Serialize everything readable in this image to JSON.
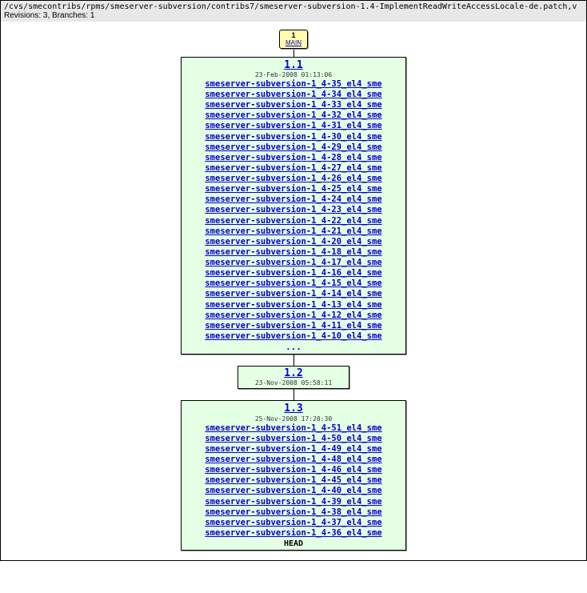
{
  "header": {
    "path": "/cvs/smecontribs/rpms/smeserver-subversion/contribs7/smeserver-subversion-1.4-ImplementReadWriteAccessLocale-de.patch,v",
    "stats": "Revisions: 3, Branches: 1"
  },
  "branch": {
    "num": "1",
    "name": "MAIN"
  },
  "rev1": {
    "title": "1.1",
    "date": "23-Feb-2008 01:13:06",
    "tags": [
      "smeserver-subversion-1_4-35_el4_sme",
      "smeserver-subversion-1_4-34_el4_sme",
      "smeserver-subversion-1_4-33_el4_sme",
      "smeserver-subversion-1_4-32_el4_sme",
      "smeserver-subversion-1_4-31_el4_sme",
      "smeserver-subversion-1_4-30_el4_sme",
      "smeserver-subversion-1_4-29_el4_sme",
      "smeserver-subversion-1_4-28_el4_sme",
      "smeserver-subversion-1_4-27_el4_sme",
      "smeserver-subversion-1_4-26_el4_sme",
      "smeserver-subversion-1_4-25_el4_sme",
      "smeserver-subversion-1_4-24_el4_sme",
      "smeserver-subversion-1_4-23_el4_sme",
      "smeserver-subversion-1_4-22_el4_sme",
      "smeserver-subversion-1_4-21_el4_sme",
      "smeserver-subversion-1_4-20_el4_sme",
      "smeserver-subversion-1_4-18_el4_sme",
      "smeserver-subversion-1_4-17_el4_sme",
      "smeserver-subversion-1_4-16_el4_sme",
      "smeserver-subversion-1_4-15_el4_sme",
      "smeserver-subversion-1_4-14_el4_sme",
      "smeserver-subversion-1_4-13_el4_sme",
      "smeserver-subversion-1_4-12_el4_sme",
      "smeserver-subversion-1_4-11_el4_sme",
      "smeserver-subversion-1_4-10_el4_sme"
    ],
    "more": "..."
  },
  "rev2": {
    "title": "1.2",
    "date": "23-Nov-2008 05:58:11"
  },
  "rev3": {
    "title": "1.3",
    "date": "25-Nov-2008 17:20:30",
    "tags": [
      "smeserver-subversion-1_4-51_el4_sme",
      "smeserver-subversion-1_4-50_el4_sme",
      "smeserver-subversion-1_4-49_el4_sme",
      "smeserver-subversion-1_4-48_el4_sme",
      "smeserver-subversion-1_4-46_el4_sme",
      "smeserver-subversion-1_4-45_el4_sme",
      "smeserver-subversion-1_4-40_el4_sme",
      "smeserver-subversion-1_4-39_el4_sme",
      "smeserver-subversion-1_4-38_el4_sme",
      "smeserver-subversion-1_4-37_el4_sme",
      "smeserver-subversion-1_4-36_el4_sme"
    ],
    "head": "HEAD"
  }
}
